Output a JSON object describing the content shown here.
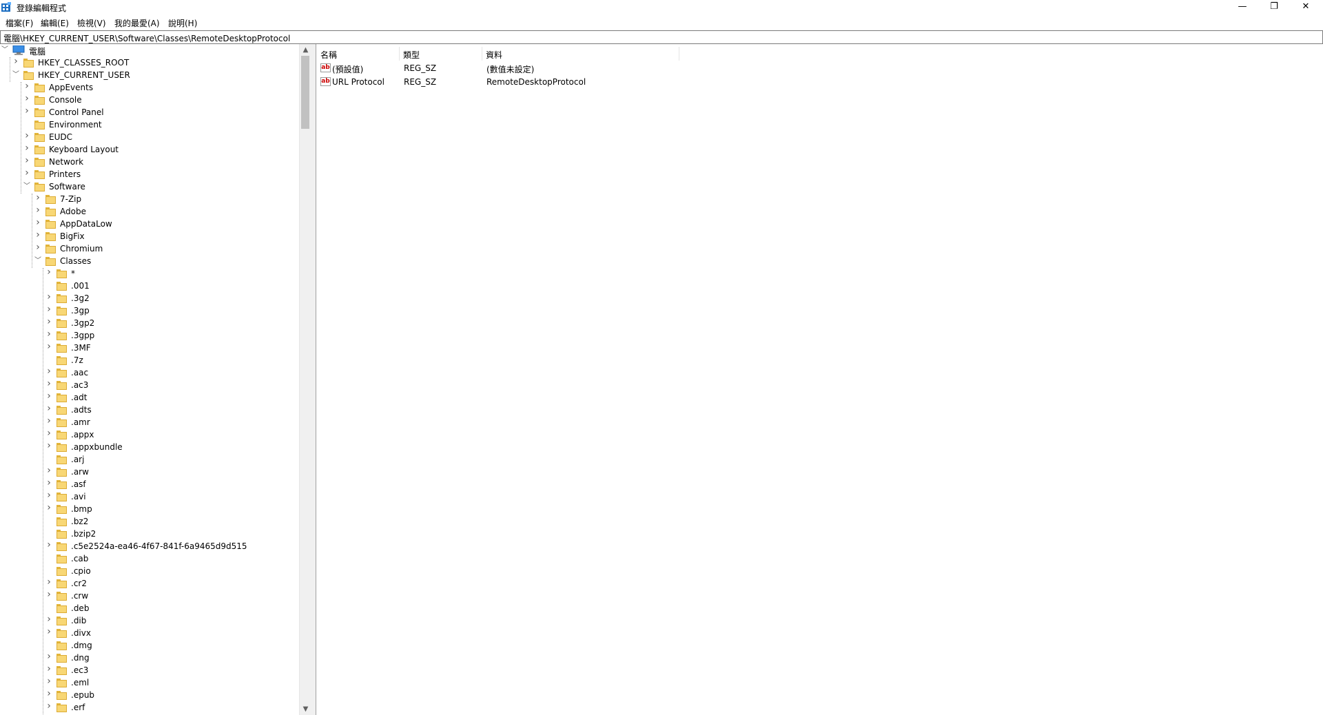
{
  "window": {
    "title": "登錄編輯程式",
    "min": "—",
    "max": "❐",
    "close": "✕"
  },
  "menu": [
    "檔案(F)",
    "編輯(E)",
    "檢視(V)",
    "我的最愛(A)",
    "說明(H)"
  ],
  "address": "電腦\\HKEY_CURRENT_USER\\Software\\Classes\\RemoteDesktopProtocol",
  "tree": [
    {
      "label": "電腦",
      "depth": 0,
      "exp": "open",
      "icon": "pc"
    },
    {
      "label": "HKEY_CLASSES_ROOT",
      "depth": 1,
      "exp": "closed"
    },
    {
      "label": "HKEY_CURRENT_USER",
      "depth": 1,
      "exp": "open"
    },
    {
      "label": "AppEvents",
      "depth": 2,
      "exp": "closed"
    },
    {
      "label": "Console",
      "depth": 2,
      "exp": "closed"
    },
    {
      "label": "Control Panel",
      "depth": 2,
      "exp": "closed"
    },
    {
      "label": "Environment",
      "depth": 2,
      "exp": "none"
    },
    {
      "label": "EUDC",
      "depth": 2,
      "exp": "closed"
    },
    {
      "label": "Keyboard Layout",
      "depth": 2,
      "exp": "closed"
    },
    {
      "label": "Network",
      "depth": 2,
      "exp": "closed"
    },
    {
      "label": "Printers",
      "depth": 2,
      "exp": "closed"
    },
    {
      "label": "Software",
      "depth": 2,
      "exp": "open"
    },
    {
      "label": "7-Zip",
      "depth": 3,
      "exp": "closed"
    },
    {
      "label": "Adobe",
      "depth": 3,
      "exp": "closed"
    },
    {
      "label": "AppDataLow",
      "depth": 3,
      "exp": "closed"
    },
    {
      "label": "BigFix",
      "depth": 3,
      "exp": "closed"
    },
    {
      "label": "Chromium",
      "depth": 3,
      "exp": "closed"
    },
    {
      "label": "Classes",
      "depth": 3,
      "exp": "open"
    },
    {
      "label": "*",
      "depth": 4,
      "exp": "closed"
    },
    {
      "label": ".001",
      "depth": 4,
      "exp": "none"
    },
    {
      "label": ".3g2",
      "depth": 4,
      "exp": "closed"
    },
    {
      "label": ".3gp",
      "depth": 4,
      "exp": "closed"
    },
    {
      "label": ".3gp2",
      "depth": 4,
      "exp": "closed"
    },
    {
      "label": ".3gpp",
      "depth": 4,
      "exp": "closed"
    },
    {
      "label": ".3MF",
      "depth": 4,
      "exp": "closed"
    },
    {
      "label": ".7z",
      "depth": 4,
      "exp": "none"
    },
    {
      "label": ".aac",
      "depth": 4,
      "exp": "closed"
    },
    {
      "label": ".ac3",
      "depth": 4,
      "exp": "closed"
    },
    {
      "label": ".adt",
      "depth": 4,
      "exp": "closed"
    },
    {
      "label": ".adts",
      "depth": 4,
      "exp": "closed"
    },
    {
      "label": ".amr",
      "depth": 4,
      "exp": "closed"
    },
    {
      "label": ".appx",
      "depth": 4,
      "exp": "closed"
    },
    {
      "label": ".appxbundle",
      "depth": 4,
      "exp": "closed"
    },
    {
      "label": ".arj",
      "depth": 4,
      "exp": "none"
    },
    {
      "label": ".arw",
      "depth": 4,
      "exp": "closed"
    },
    {
      "label": ".asf",
      "depth": 4,
      "exp": "closed"
    },
    {
      "label": ".avi",
      "depth": 4,
      "exp": "closed"
    },
    {
      "label": ".bmp",
      "depth": 4,
      "exp": "closed"
    },
    {
      "label": ".bz2",
      "depth": 4,
      "exp": "none"
    },
    {
      "label": ".bzip2",
      "depth": 4,
      "exp": "none"
    },
    {
      "label": ".c5e2524a-ea46-4f67-841f-6a9465d9d515",
      "depth": 4,
      "exp": "closed"
    },
    {
      "label": ".cab",
      "depth": 4,
      "exp": "none"
    },
    {
      "label": ".cpio",
      "depth": 4,
      "exp": "none"
    },
    {
      "label": ".cr2",
      "depth": 4,
      "exp": "closed"
    },
    {
      "label": ".crw",
      "depth": 4,
      "exp": "closed"
    },
    {
      "label": ".deb",
      "depth": 4,
      "exp": "none"
    },
    {
      "label": ".dib",
      "depth": 4,
      "exp": "closed"
    },
    {
      "label": ".divx",
      "depth": 4,
      "exp": "closed"
    },
    {
      "label": ".dmg",
      "depth": 4,
      "exp": "none"
    },
    {
      "label": ".dng",
      "depth": 4,
      "exp": "closed"
    },
    {
      "label": ".ec3",
      "depth": 4,
      "exp": "closed"
    },
    {
      "label": ".eml",
      "depth": 4,
      "exp": "closed"
    },
    {
      "label": ".epub",
      "depth": 4,
      "exp": "closed"
    },
    {
      "label": ".erf",
      "depth": 4,
      "exp": "closed"
    }
  ],
  "list": {
    "columns": [
      "名稱",
      "類型",
      "資料"
    ],
    "rows": [
      {
        "name": "(預設值)",
        "type": "REG_SZ",
        "data": "(數值未設定)"
      },
      {
        "name": "URL Protocol",
        "type": "REG_SZ",
        "data": "RemoteDesktopProtocol"
      }
    ]
  },
  "icons": {
    "value": "ab-string-icon",
    "folder": "folder-icon",
    "computer": "computer-icon"
  }
}
